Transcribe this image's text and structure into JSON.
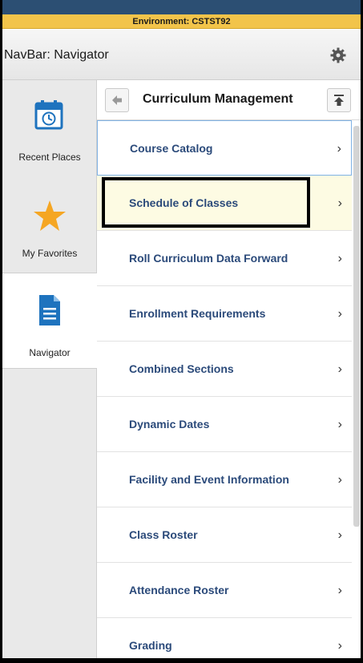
{
  "environment_label": "Environment: CSTST92",
  "header": {
    "title": "NavBar: Navigator",
    "gear_icon": "gear-icon"
  },
  "rail": {
    "items": [
      {
        "label": "Recent Places",
        "icon": "calendar-clock-icon"
      },
      {
        "label": "My Favorites",
        "icon": "star-icon"
      },
      {
        "label": "Navigator",
        "icon": "document-icon"
      }
    ]
  },
  "panel": {
    "title": "Curriculum Management",
    "back_icon": "back-arrow-icon",
    "top_icon": "scroll-to-top-icon",
    "items": [
      {
        "label": "Course Catalog"
      },
      {
        "label": "Schedule of Classes"
      },
      {
        "label": "Roll Curriculum Data Forward"
      },
      {
        "label": "Enrollment Requirements"
      },
      {
        "label": "Combined Sections"
      },
      {
        "label": "Dynamic Dates"
      },
      {
        "label": "Facility and Event Information"
      },
      {
        "label": "Class Roster"
      },
      {
        "label": "Attendance Roster"
      },
      {
        "label": "Grading"
      }
    ],
    "chevron": "›"
  },
  "colors": {
    "env_bar": "#f2c44a",
    "link": "#2b4a7a",
    "star": "#f5a623",
    "icon_blue": "#1e73be"
  }
}
